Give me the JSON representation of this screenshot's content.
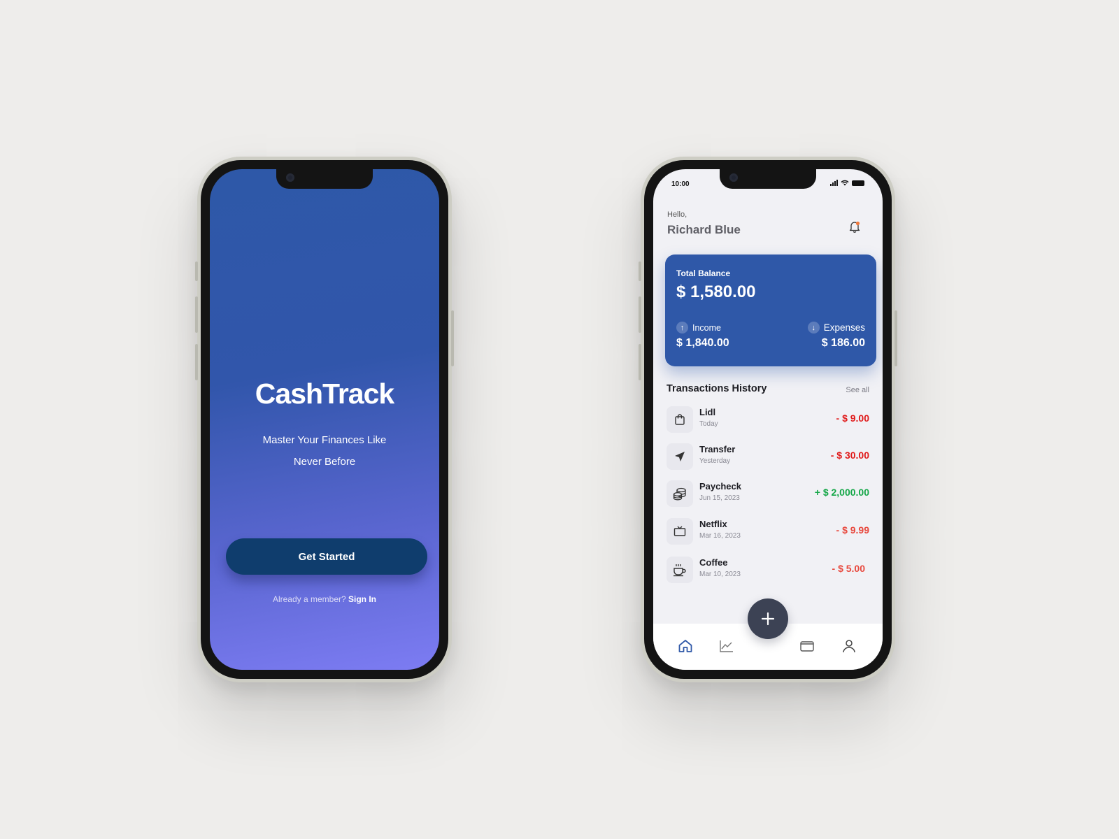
{
  "splash": {
    "brand": "CashTrack",
    "tagline_line1": "Master Your Finances Like",
    "tagline_line2": "Never Before",
    "cta_label": "Get Started",
    "member_text": "Already a member? ",
    "sign_in_label": "Sign In",
    "colors": {
      "gradient_top": "#2e58a8",
      "gradient_bottom": "#7d7cf3",
      "button": "#0f3d6d"
    }
  },
  "home": {
    "status_time": "10:00",
    "greeting": "Hello,",
    "user_name": "Richard Blue",
    "balance": {
      "label": "Total Balance",
      "total": "$ 1,580.00",
      "income_label": "Income",
      "income_value": "$ 1,840.00",
      "expenses_label": "Expenses",
      "expenses_value": "$ 186.00",
      "card_color": "#2f58a8"
    },
    "history_title": "Transactions History",
    "see_all": "See all",
    "transactions": [
      {
        "icon": "shopping-bag-icon",
        "name": "Lidl",
        "date": "Today",
        "amount": "- $ 9.00"
      },
      {
        "icon": "send-icon",
        "name": "Transfer",
        "date": "Yesterday",
        "amount": "- $ 30.00"
      },
      {
        "icon": "coins-icon",
        "name": "Paycheck",
        "date": "Jun 15, 2023",
        "amount": "+ $ 2,000.00"
      },
      {
        "icon": "tv-icon",
        "name": "Netflix",
        "date": "Mar 16, 2023",
        "amount": "- $ 9.99"
      },
      {
        "icon": "coffee-icon",
        "name": "Coffee",
        "date": "Mar 10, 2023",
        "amount": "- $ 5.00"
      }
    ],
    "nav_icons": [
      "home-icon",
      "chart-icon",
      "add-icon",
      "wallet-icon",
      "profile-icon"
    ],
    "colors": {
      "negative": "#e01a1a",
      "positive": "#15a748",
      "fab": "#3c4254"
    }
  }
}
